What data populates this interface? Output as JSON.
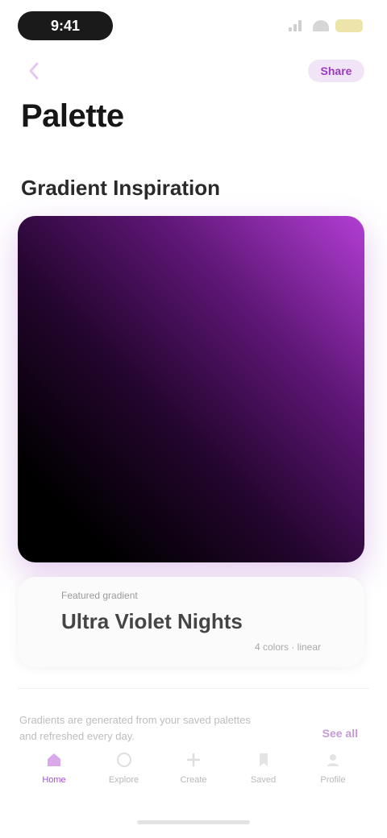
{
  "status_bar": {
    "time": "9:41",
    "icons": [
      "signal-icon",
      "wifi-icon",
      "battery-icon"
    ]
  },
  "nav": {
    "back_icon": "chevron-left-icon",
    "action_label": "Share"
  },
  "page": {
    "title": "Palette"
  },
  "section": {
    "title": "Gradient Inspiration"
  },
  "gradient_card": {
    "colors": [
      "#000000",
      "#23052d",
      "#5e1676",
      "#b23ed4"
    ]
  },
  "info_card": {
    "caption": "Featured gradient",
    "title": "Ultra Violet Nights",
    "meta": "4 colors · linear"
  },
  "footer": {
    "text_line1": "Gradients are generated from your saved palettes",
    "text_line2": "and refreshed every day.",
    "link_label": "See all"
  },
  "tabs": [
    {
      "label": "Home",
      "icon": "home-icon",
      "active": true
    },
    {
      "label": "Explore",
      "icon": "compass-icon",
      "active": false
    },
    {
      "label": "Create",
      "icon": "plus-icon",
      "active": false
    },
    {
      "label": "Saved",
      "icon": "bookmark-icon",
      "active": false
    },
    {
      "label": "Profile",
      "icon": "user-icon",
      "active": false
    }
  ],
  "colors": {
    "accent": "#a94fd0",
    "accent_soft": "#f1e4f6"
  }
}
